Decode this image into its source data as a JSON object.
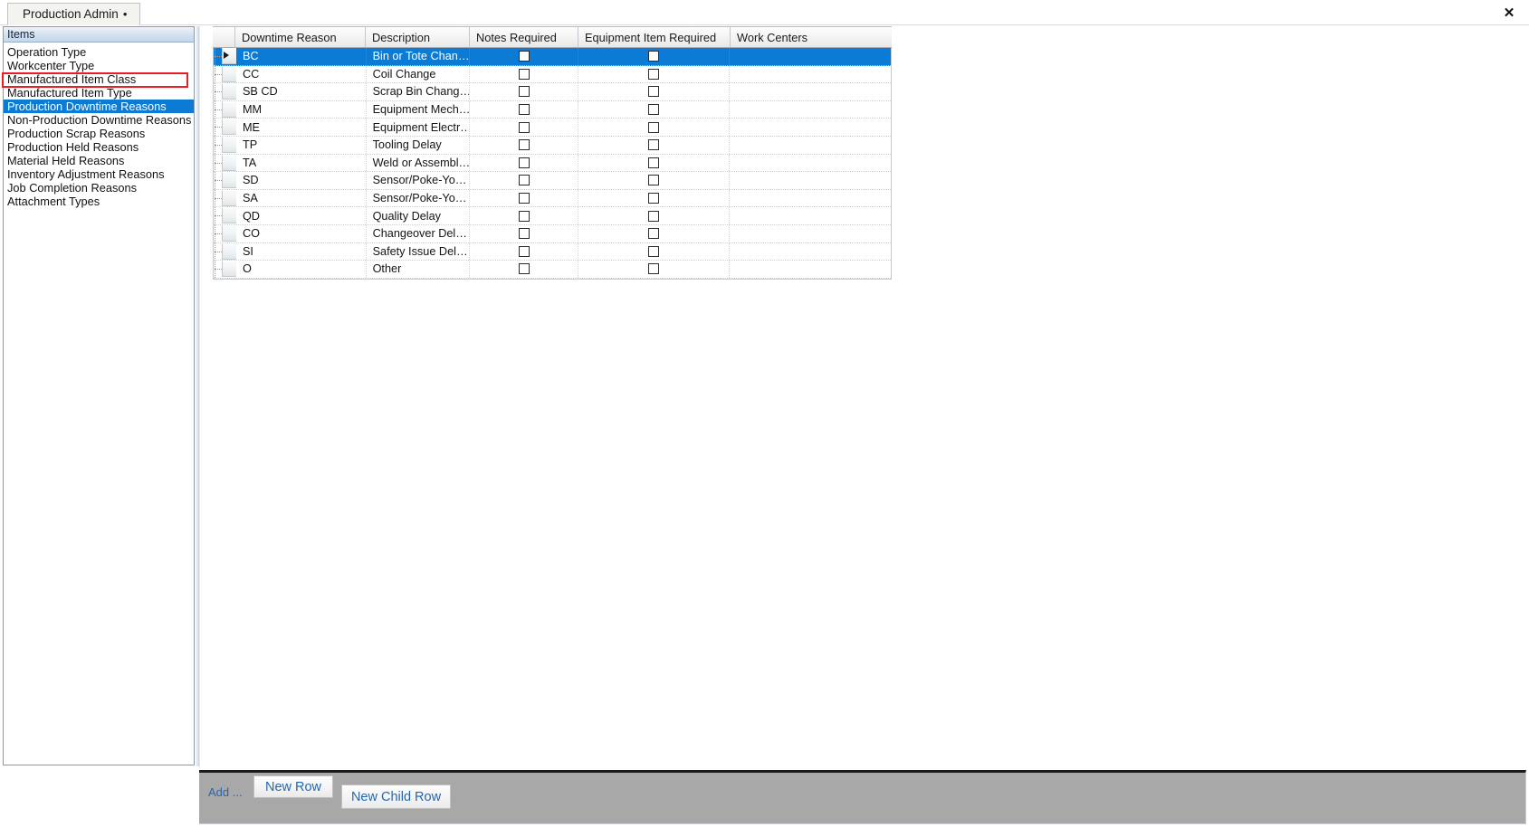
{
  "window": {
    "tab_title": "Production Admin",
    "dirty_marker": "•",
    "close_label": "✕"
  },
  "sidebar": {
    "header": "Items",
    "items": [
      {
        "label": "Operation Type",
        "selected": false
      },
      {
        "label": "Workcenter Type",
        "selected": false
      },
      {
        "label": "Manufactured Item Class",
        "selected": false
      },
      {
        "label": "Manufactured Item Type",
        "selected": false
      },
      {
        "label": "Production Downtime Reasons",
        "selected": true
      },
      {
        "label": "Non-Production Downtime Reasons",
        "selected": false
      },
      {
        "label": "Production Scrap Reasons",
        "selected": false
      },
      {
        "label": "Production Held Reasons",
        "selected": false
      },
      {
        "label": "Material Held Reasons",
        "selected": false
      },
      {
        "label": "Inventory Adjustment Reasons",
        "selected": false
      },
      {
        "label": "Job Completion Reasons",
        "selected": false
      },
      {
        "label": "Attachment Types",
        "selected": false
      }
    ],
    "highlight_color": "#ec1c24",
    "selection_color": "#0c7bd6"
  },
  "grid": {
    "columns": [
      {
        "key": "reason",
        "label": "Downtime Reason"
      },
      {
        "key": "description",
        "label": "Description"
      },
      {
        "key": "notes_required",
        "label": "Notes Required"
      },
      {
        "key": "equipment_item_required",
        "label": "Equipment Item Required"
      },
      {
        "key": "work_centers",
        "label": "Work Centers"
      }
    ],
    "rows": [
      {
        "reason": "BC",
        "description": "Bin or Tote Chan…",
        "notes_required": false,
        "equipment_item_required": false,
        "work_centers": "",
        "selected": true
      },
      {
        "reason": "CC",
        "description": "Coil Change",
        "notes_required": false,
        "equipment_item_required": false,
        "work_centers": "",
        "selected": false
      },
      {
        "reason": "SB CD",
        "description": "Scrap Bin Chang…",
        "notes_required": false,
        "equipment_item_required": false,
        "work_centers": "",
        "selected": false
      },
      {
        "reason": "MM",
        "description": "Equipment  Mech…",
        "notes_required": false,
        "equipment_item_required": false,
        "work_centers": "",
        "selected": false
      },
      {
        "reason": "ME",
        "description": "Equipment  Electr…",
        "notes_required": false,
        "equipment_item_required": false,
        "work_centers": "",
        "selected": false
      },
      {
        "reason": "TP",
        "description": "Tooling Delay",
        "notes_required": false,
        "equipment_item_required": false,
        "work_centers": "",
        "selected": false
      },
      {
        "reason": "TA",
        "description": "Weld or Assembl…",
        "notes_required": false,
        "equipment_item_required": false,
        "work_centers": "",
        "selected": false
      },
      {
        "reason": "SD",
        "description": "Sensor/Poke-Yo…",
        "notes_required": false,
        "equipment_item_required": false,
        "work_centers": "",
        "selected": false
      },
      {
        "reason": "SA",
        "description": "Sensor/Poke-Yo…",
        "notes_required": false,
        "equipment_item_required": false,
        "work_centers": "",
        "selected": false
      },
      {
        "reason": "QD",
        "description": "Quality Delay",
        "notes_required": false,
        "equipment_item_required": false,
        "work_centers": "",
        "selected": false
      },
      {
        "reason": "CO",
        "description": "Changeover  Del…",
        "notes_required": false,
        "equipment_item_required": false,
        "work_centers": "",
        "selected": false
      },
      {
        "reason": "SI",
        "description": "Safety Issue Del…",
        "notes_required": false,
        "equipment_item_required": false,
        "work_centers": "",
        "selected": false
      },
      {
        "reason": "O",
        "description": "Other",
        "notes_required": false,
        "equipment_item_required": false,
        "work_centers": "",
        "selected": false
      }
    ]
  },
  "toolbar": {
    "add_label": "Add ...",
    "new_row_label": "New Row",
    "new_child_row_label": "New Child Row",
    "link_color": "#2567b0",
    "background": "#a8a8a8"
  }
}
